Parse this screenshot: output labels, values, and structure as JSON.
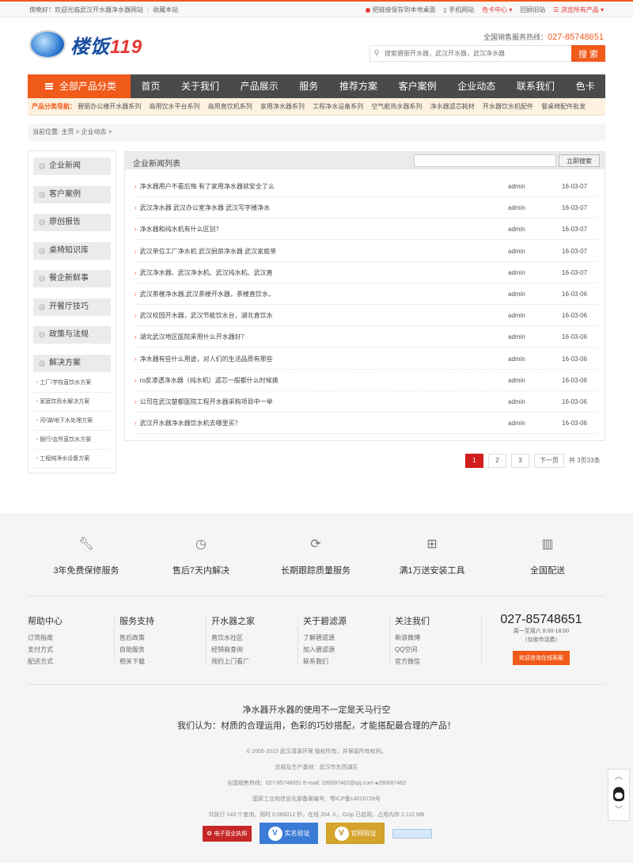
{
  "topbar": {
    "welcome": "傍晚好！欢迎光临武汉开水器净水器网站",
    "bookmark": "收藏本站",
    "save_desktop": "把链接保存到本地桌面",
    "mobile": "手机网站",
    "color_center": "色卡中心",
    "old_site": "回顾旧站",
    "browse_all": "浏览所有产品"
  },
  "header": {
    "logo_cn": "楼饭",
    "logo_num": "119",
    "hotline_label": "全国销售服务热线：",
    "hotline": "027-85748651",
    "search_placeholder": "搜索碧丽开水器，武汉开水器，武汉净水器",
    "search_button": "搜 索"
  },
  "nav": {
    "all_products": "全部产品分类",
    "items": [
      "首页",
      "关于我们",
      "产品展示",
      "服务",
      "推荐方案",
      "客户案例",
      "企业动态",
      "联系我们",
      "色卡"
    ]
  },
  "catnav": {
    "label": "产品分类导航：",
    "items": [
      "碧丽办公楼开水器系列",
      "商用饮水平台系列",
      "商用直饮机系列",
      "家用净水器系列",
      "工程净水设备系列",
      "空气能热水器系列",
      "净水器滤芯耗材",
      "开水器饮水机配件",
      "餐桌椅配件批发"
    ]
  },
  "breadcrumb": "当前位置: 主页 > 企业动态 >",
  "sidebar": {
    "categories": [
      "企业新闻",
      "客户案例",
      "原创报告",
      "桌椅知识库",
      "餐企新鲜事",
      "开餐厅技巧",
      "政策与法规",
      "解决方案"
    ],
    "sub_items": [
      "- 工厂/学校直饮水方案",
      "- 家庭饮用水解决方案",
      "- 河/湖/地下水处理方案",
      "- 银行/会所直饮水方案",
      "- 工程纯净水设备方案"
    ]
  },
  "news": {
    "title": "企业新闻列表",
    "search_button": "立即搜索",
    "rows": [
      {
        "title": "净水器用户不看后悔 有了家用净水器就安全了么",
        "user": "admin",
        "date": "16-03-07"
      },
      {
        "title": "武汉净水器 武汉办公室净水器 武汉写字楼净水",
        "user": "admin",
        "date": "16-03-07"
      },
      {
        "title": "净水器和纯水机有什么区别？",
        "user": "admin",
        "date": "16-03-07"
      },
      {
        "title": "武汉单位工厂净水机 武汉厨房净水器 武汉家庭单",
        "user": "admin",
        "date": "16-03-07"
      },
      {
        "title": "武汉净水器、武汉净水机、武汉纯水机、武汉直",
        "user": "admin",
        "date": "16-03-07"
      },
      {
        "title": "武汉茶楼净水器,武汉茶楼开水器，茶楼直饮水，",
        "user": "admin",
        "date": "16-03-06"
      },
      {
        "title": "武汉校园开水器，武汉节能饮水台，湖北直饮水",
        "user": "admin",
        "date": "16-03-06"
      },
      {
        "title": "湖北武汉地区医院采用什么开水器好？",
        "user": "admin",
        "date": "16-03-06"
      },
      {
        "title": "净水器有些什么用途，对人们的生活品质有那些",
        "user": "admin",
        "date": "16-03-06"
      },
      {
        "title": "ro反渗透净水器（纯水机）滤芯一般都什么时候换",
        "user": "admin",
        "date": "16-03-06"
      },
      {
        "title": "公司在武汉楚都医院工程开水器采购项目中一举",
        "user": "admin",
        "date": "16-03-06"
      },
      {
        "title": "武汉开水器净水器饮水机去哪里买？",
        "user": "admin",
        "date": "16-03-06"
      }
    ]
  },
  "pager": {
    "pages": [
      "1",
      "2",
      "3"
    ],
    "next": "下一页",
    "total": "共 3页33条"
  },
  "services": [
    "3年免费保修服务",
    "售后7天内解决",
    "长期跟踪质量服务",
    "满1万送安装工具",
    "全国配送"
  ],
  "footer_cols": [
    {
      "title": "帮助中心",
      "items": [
        "订货指南",
        "支付方式",
        "配送方式"
      ]
    },
    {
      "title": "服务支持",
      "items": [
        "售后政策",
        "自助服务",
        "相关下载"
      ]
    },
    {
      "title": "开水器之家",
      "items": [
        "直饮水社区",
        "经销商查询",
        "预约上门看厂"
      ]
    },
    {
      "title": "关于碧滤源",
      "items": [
        "了解碧滤源",
        "加入碧滤源",
        "联系我们"
      ]
    },
    {
      "title": "关注我们",
      "items": [
        "新浪微博",
        "QQ空间",
        "官方微信"
      ]
    }
  ],
  "footer_phone": {
    "number": "027-85748651",
    "hours": "周一至周六 8:00-18:00",
    "note": "（仅收市话费）",
    "button": "欢迎咨询在线客服"
  },
  "slogan": {
    "line1": "净水器开水器的使用不一定是天马行空",
    "line2": "我们认为：材质的合理运用，色彩的巧妙搭配，才能搭配最合理的产品！"
  },
  "legal": {
    "copyright": "© 2005-2015 武汉清源环保 版权所有，并保留所有权利。",
    "address": "总部及生产基地：武汉市东西湖区",
    "contact": "全国销售热线：027-85748651    E-mail: 290097462@qq.com",
    "qq": "290097462",
    "icp": "国家工业和信息化部备案编号：鄂ICP备14016728号",
    "stats": "共执行 143 个查询，用时 0.065012 秒，在线 204 人，Gzip 已启用，占用内存 2.112 MB"
  },
  "badges": [
    "电子营业执照",
    "实名验证",
    "官网验证"
  ]
}
